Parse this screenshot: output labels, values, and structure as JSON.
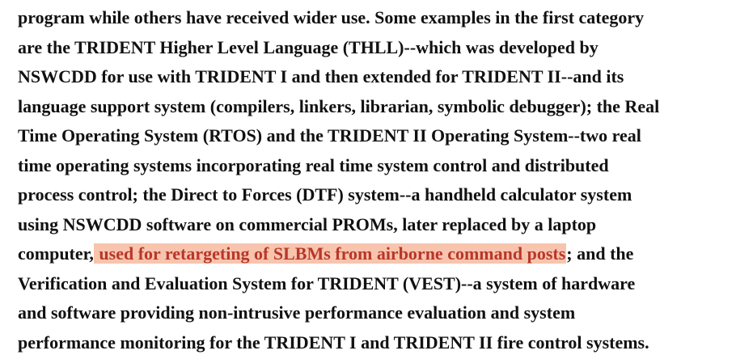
{
  "document": {
    "lines": [
      {
        "text": "program while others have received wider use.  Some examples in the first category"
      },
      {
        "text": "are the TRIDENT Higher Level Language (THLL)--which was developed by"
      },
      {
        "text": "NSWCDD for use with TRIDENT I and then extended for TRIDENT II--and its"
      },
      {
        "text": "language support system (compilers, linkers, librarian, symbolic debugger);  the Real"
      },
      {
        "text": "Time Operating System (RTOS) and the TRIDENT II Operating System--two    real"
      },
      {
        "text": "time operating systems incorporating real time system control and distributed"
      },
      {
        "text": "process control;  the Direct to Forces (DTF) system--a handheld calculator system"
      },
      {
        "text": "using NSWCDD software on commercial PROMs, later replaced by a laptop"
      },
      {
        "before": "computer,",
        "highlight": " used for retargeting of SLBMs from airborne command posts",
        "after": ";  and the"
      },
      {
        "text": "Verification and Evaluation System for TRIDENT (VEST)--a system of hardware"
      },
      {
        "text": "and software providing non-intrusive performance evaluation and system"
      },
      {
        "text": "performance monitoring for the TRIDENT I and TRIDENT II fire control systems."
      }
    ],
    "colors": {
      "text": "#111111",
      "highlight_background": "#f8c4ae",
      "highlight_text": "#b8372a"
    }
  }
}
